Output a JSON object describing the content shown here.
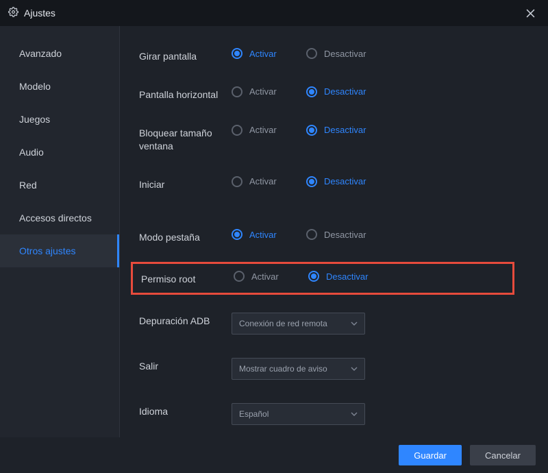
{
  "titlebar": {
    "title": "Ajustes"
  },
  "sidebar": {
    "items": [
      {
        "label": "Avanzado"
      },
      {
        "label": "Modelo"
      },
      {
        "label": "Juegos"
      },
      {
        "label": "Audio"
      },
      {
        "label": "Red"
      },
      {
        "label": "Accesos directos"
      },
      {
        "label": "Otros ajustes"
      }
    ]
  },
  "options": {
    "activate": "Activar",
    "deactivate": "Desactivar"
  },
  "settings": {
    "rotate_screen": {
      "label": "Girar pantalla"
    },
    "horizontal_screen": {
      "label": "Pantalla horizontal"
    },
    "lock_window_size": {
      "label": "Bloquear tamaño ventana"
    },
    "start": {
      "label": "Iniciar"
    },
    "tab_mode": {
      "label": "Modo pestaña"
    },
    "root_permission": {
      "label": "Permiso root"
    },
    "adb_debug": {
      "label": "Depuración ADB",
      "value": "Conexión de red remota"
    },
    "exit": {
      "label": "Salir",
      "value": "Mostrar cuadro de aviso"
    },
    "language": {
      "label": "Idioma",
      "value": "Español"
    }
  },
  "footer": {
    "save": "Guardar",
    "cancel": "Cancelar"
  },
  "colors": {
    "accent": "#2f86ff",
    "highlight": "#e74b3c"
  }
}
